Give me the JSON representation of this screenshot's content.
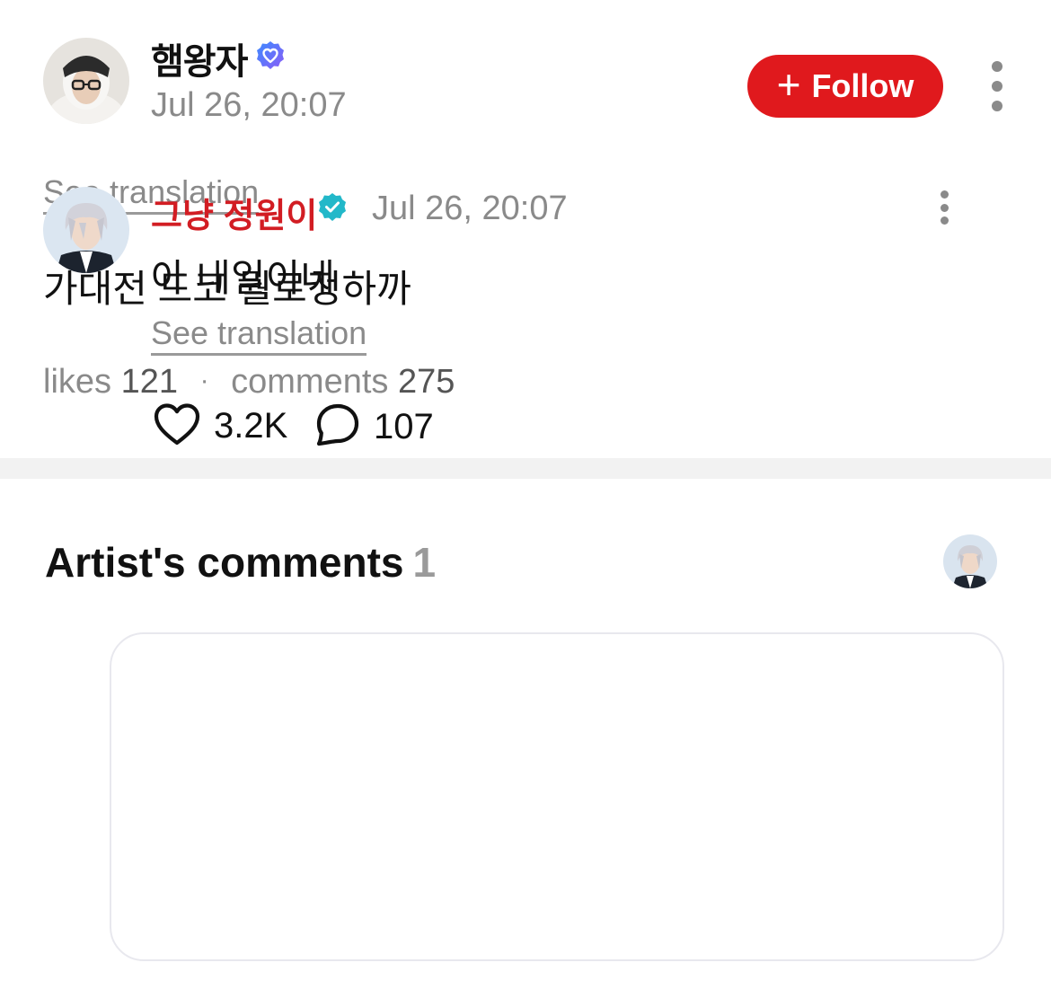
{
  "post": {
    "author": {
      "name": "햄왕자",
      "verified_icon": "verified-heart-badge-icon",
      "avatar": "author-avatar"
    },
    "date": "Jul 26, 20:07",
    "follow_button": {
      "icon": "plus-icon",
      "plus": "+",
      "label": "Follow"
    },
    "more_icon": "kebab-menu-icon",
    "see_translation": "See translation",
    "body": "가대전 드코 뭘로정하까",
    "stats": {
      "likes_label": "likes",
      "likes_count": "121",
      "separator": "·",
      "comments_label": "comments",
      "comments_count": "275"
    }
  },
  "artist_comments": {
    "title": "Artist's comments",
    "count": "1",
    "artist_avatar": "artist-avatar",
    "comment": {
      "author": "그냥 정원이",
      "verified_icon": "verified-check-badge-icon",
      "date": "Jul 26, 20:07",
      "more_icon": "kebab-menu-icon",
      "body": "아 내일이네",
      "see_translation": "See translation",
      "likes": {
        "icon": "heart-icon",
        "count": "3.2K"
      },
      "replies": {
        "icon": "speech-bubble-icon",
        "count": "107"
      }
    }
  },
  "colors": {
    "accent_red": "#e0191d",
    "artist_name_red": "#d21d23",
    "verified_blue": "#4f6df5",
    "verified_teal": "#22b8c9",
    "muted_text": "#8a8a8a",
    "divider": "#f2f2f2"
  }
}
